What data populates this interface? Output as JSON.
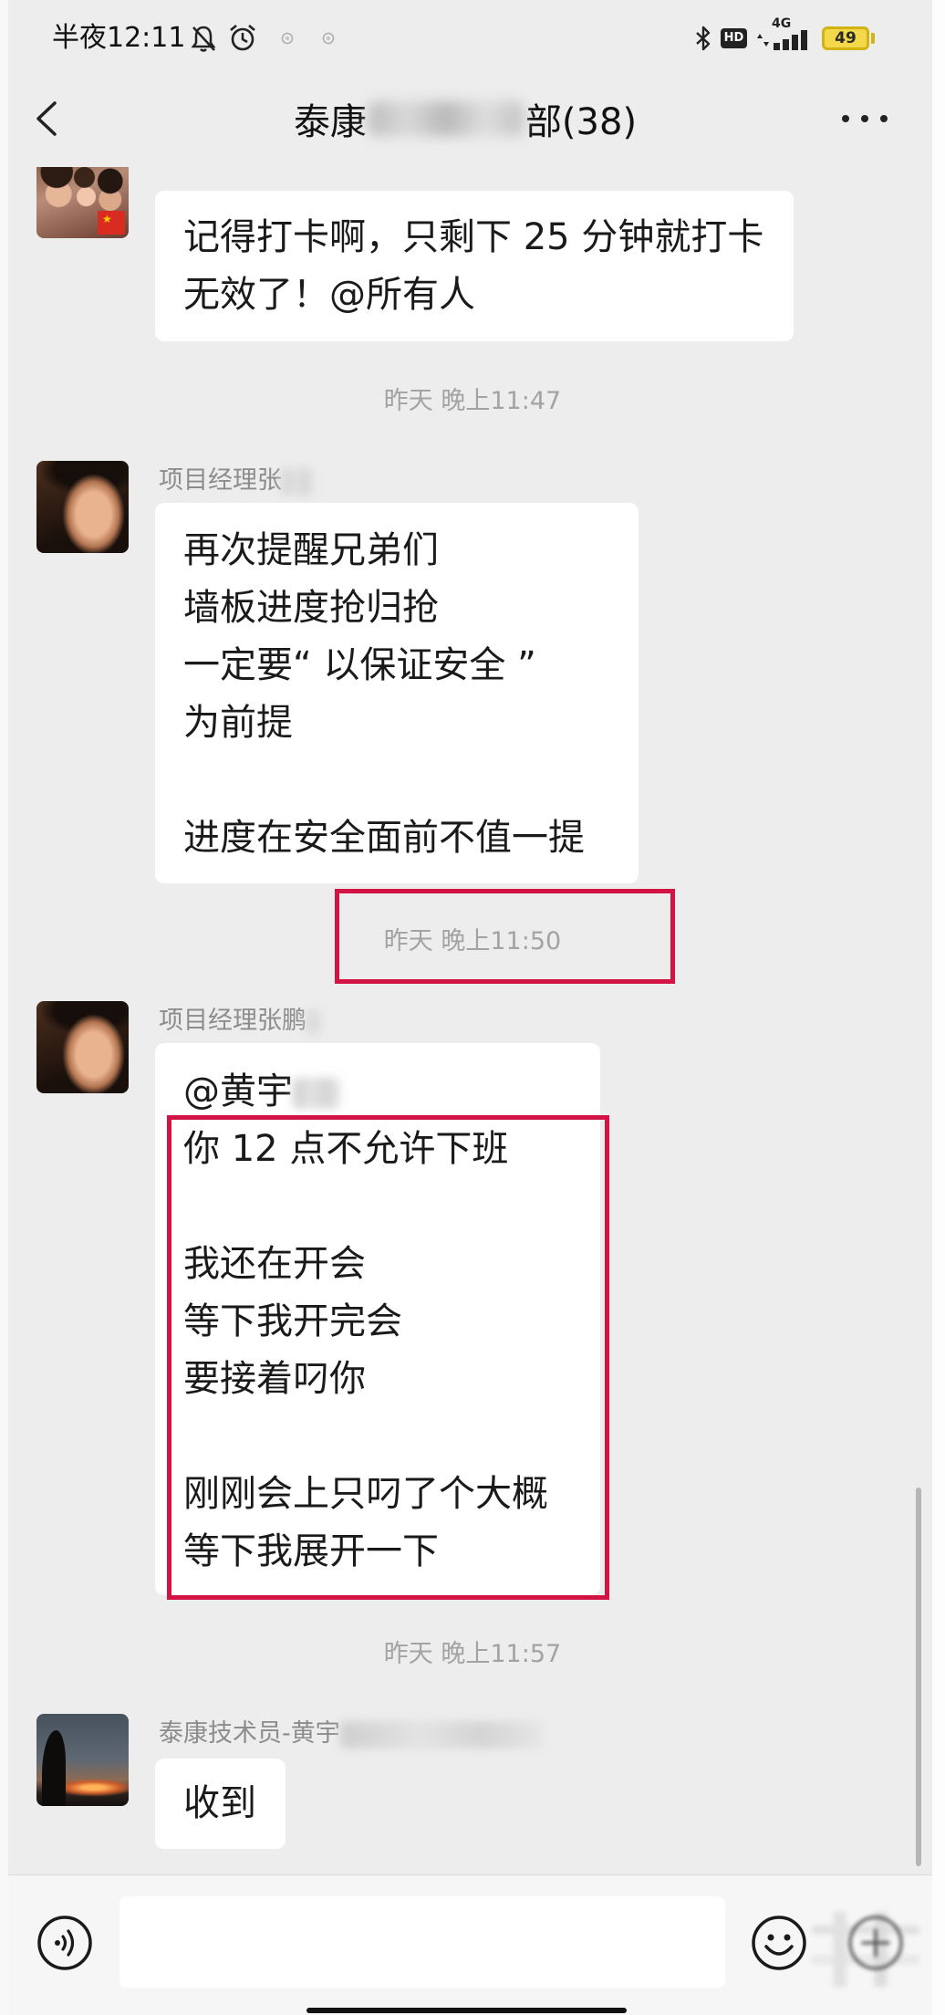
{
  "status_bar": {
    "time": "半夜12:11",
    "left_icons": [
      "mute-bell-icon",
      "alarm-clock-icon",
      "notification-dot-icon",
      "notification-dot-icon"
    ],
    "right_icons": [
      "bluetooth-icon",
      "hd-badge",
      "signal-bars-icon",
      "battery-icon"
    ],
    "hd_label": "HD",
    "network_label": "4G",
    "battery_level": "49"
  },
  "header": {
    "back_icon": "chevron-left-icon",
    "title_start": "泰康",
    "title_end": "部(38)",
    "more_icon": "more-dots-icon"
  },
  "timestamps": [
    "昨天 晚上11:47",
    "昨天 晚上11:50",
    "昨天 晚上11:57"
  ],
  "messages": [
    {
      "lines": [
        "记得打卡啊，只剩下 25 分钟就打卡",
        "无效了！@所有人"
      ]
    },
    {
      "sender": "项目经理张",
      "lines": [
        "再次提醒兄弟们",
        "墙板进度抢归抢",
        "一定要“ 以保证安全 ”",
        "为前提",
        "",
        "进度在安全面前不值一提"
      ]
    },
    {
      "sender": "项目经理张鹏",
      "lines": [
        "@黄宇",
        "你 12 点不允许下班",
        "",
        "我还在开会",
        "等下我开完会",
        "要接着叼你",
        "",
        "刚刚会上只叼了个大概",
        "等下我展开一下"
      ]
    },
    {
      "sender": "泰康技术员-黄宇",
      "lines": [
        "收到"
      ]
    }
  ],
  "input_bar": {
    "voice_icon": "voice-icon",
    "emoji_icon": "emoji-icon",
    "more_icon": "plus-icon"
  },
  "colors": {
    "chat_background": "#ededed",
    "bubble_background": "#ffffff",
    "highlight_box": "#d21445",
    "timestamp_text": "#a3a3a3",
    "battery": "#f3d84a"
  }
}
